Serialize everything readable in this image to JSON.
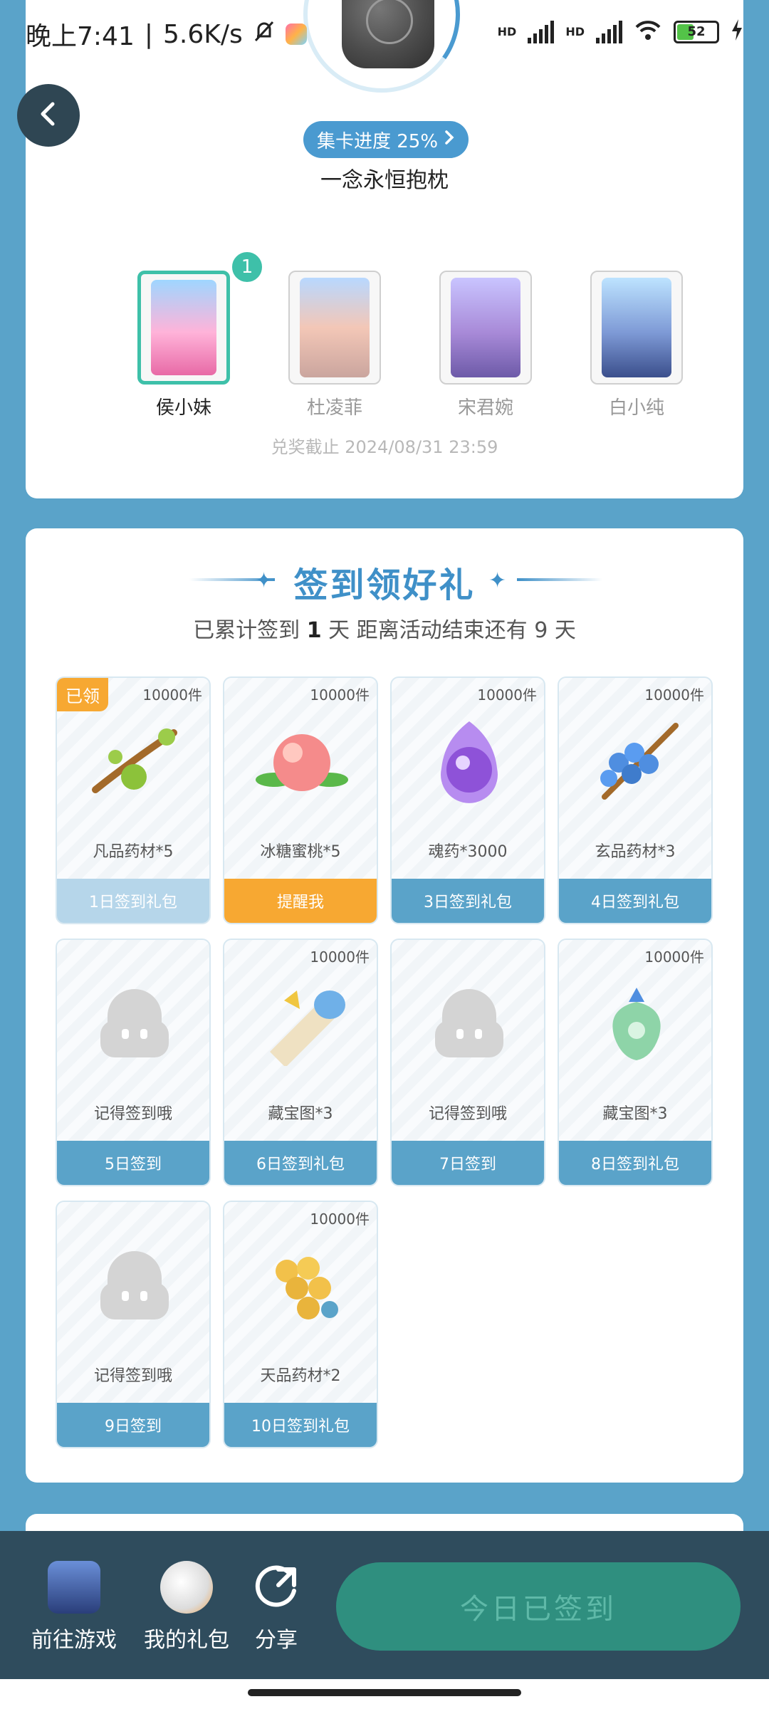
{
  "status_bar": {
    "time": "晚上7:41",
    "speed": "5.6K/s",
    "network1": "HD",
    "network2": "HD",
    "battery": "52"
  },
  "back": {
    "icon": "chevron-left-icon"
  },
  "collection": {
    "progress_label": "集卡进度 25%",
    "progress_fraction": 0.25,
    "item_name": "一念永恒抱枕",
    "characters": [
      {
        "name": "侯小妹",
        "count": "1",
        "active": true
      },
      {
        "name": "杜凌菲",
        "active": false
      },
      {
        "name": "宋君婉",
        "active": false
      },
      {
        "name": "白小纯",
        "active": false
      }
    ],
    "deadline": "兑奖截止 2024/08/31 23:59"
  },
  "checkin": {
    "title": "签到领好礼",
    "sub_prefix": "已累计签到 ",
    "sub_days": "1",
    "sub_suffix": " 天  距离活动结束还有 9 天",
    "gifts": [
      {
        "qty": "10000件",
        "name": "凡品药材*5",
        "button": "1日签到礼包",
        "claimed_label": "已领",
        "state": "done",
        "icon": "herb-branch-icon"
      },
      {
        "qty": "10000件",
        "name": "冰糖蜜桃*5",
        "button": "提醒我",
        "state": "remind",
        "icon": "peach-icon"
      },
      {
        "qty": "10000件",
        "name": "魂药*3000",
        "button": "3日签到礼包",
        "state": "normal",
        "icon": "soul-orb-icon"
      },
      {
        "qty": "10000件",
        "name": "玄品药材*3",
        "button": "4日签到礼包",
        "state": "normal",
        "icon": "berry-branch-icon"
      },
      {
        "qty": "",
        "name": "记得签到哦",
        "button": "5日签到",
        "state": "normal",
        "icon": "placeholder-mascot-icon"
      },
      {
        "qty": "10000件",
        "name": "藏宝图*3",
        "button": "6日签到礼包",
        "state": "normal",
        "icon": "treasure-scroll-icon"
      },
      {
        "qty": "",
        "name": "记得签到哦",
        "button": "7日签到",
        "state": "normal",
        "icon": "placeholder-mascot-icon"
      },
      {
        "qty": "10000件",
        "name": "藏宝图*3",
        "button": "8日签到礼包",
        "state": "normal",
        "icon": "jade-pendant-icon"
      },
      {
        "qty": "",
        "name": "记得签到哦",
        "button": "9日签到",
        "state": "normal",
        "icon": "placeholder-mascot-icon"
      },
      {
        "qty": "10000件",
        "name": "天品药材*2",
        "button": "10日签到礼包",
        "state": "normal",
        "icon": "golden-fruit-icon"
      }
    ]
  },
  "bottom_bar": {
    "go_game": "前往游戏",
    "my_gifts": "我的礼包",
    "share": "分享",
    "signed_button": "今日已签到"
  },
  "colors": {
    "accent": "#4a9ad0",
    "teal": "#3ec0a9",
    "orange": "#f7a832",
    "bottom_bar": "#2f4c5d"
  }
}
